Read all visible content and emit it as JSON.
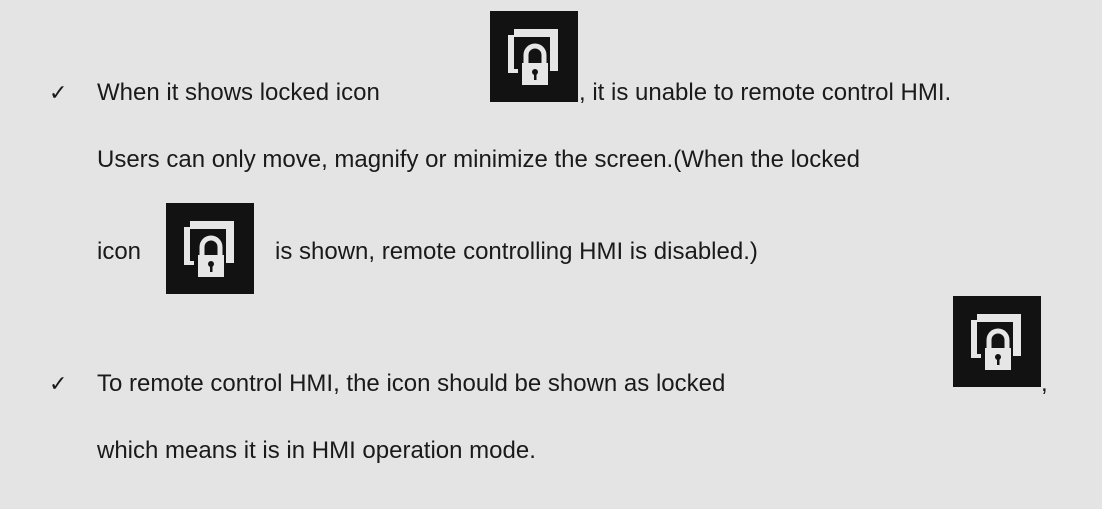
{
  "bullets": [
    {
      "check_glyph": "✓",
      "line1_a": "When it shows locked icon",
      "line1_b": ", it is unable to remote control HMI.",
      "line2": "Users can only move, magnify or minimize the screen.(When the locked",
      "line3_a": "icon",
      "line3_b": "is shown, remote controlling HMI is disabled.)"
    },
    {
      "check_glyph": "✓",
      "line1_a": "To remote control HMI, the icon should be shown as locked",
      "line1_b": ",",
      "line2": "which means it is in HMI operation mode."
    }
  ],
  "icons": {
    "lock": "lock-icon"
  },
  "colors": {
    "background": "#e4e4e4",
    "icon_bg": "#121212",
    "icon_fg": "#e6e6e6"
  }
}
